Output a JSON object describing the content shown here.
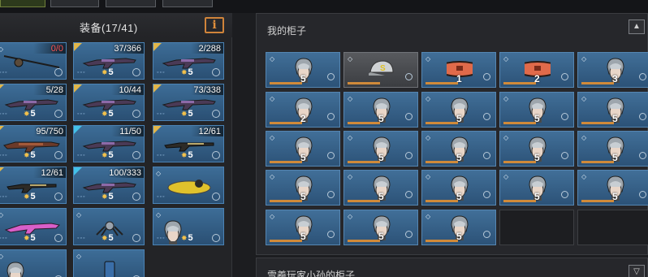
{
  "equipment": {
    "title": "装备(17/41)",
    "info_label": "i",
    "items": [
      {
        "count": "0/0",
        "count_red": true,
        "icon": "fishing-rod-icon",
        "level": "",
        "tag": ""
      },
      {
        "count": "37/366",
        "icon": "rifle-icon",
        "level": "5",
        "tag": "gold"
      },
      {
        "count": "2/288",
        "icon": "rifle-icon",
        "level": "5",
        "tag": "gold"
      },
      {
        "count": "5/28",
        "icon": "rifle-icon",
        "level": "5",
        "tag": "gold"
      },
      {
        "count": "10/44",
        "icon": "rifle-icon",
        "level": "5",
        "tag": "gold"
      },
      {
        "count": "73/338",
        "icon": "rifle-icon",
        "level": "5",
        "tag": "gold"
      },
      {
        "count": "95/750",
        "icon": "machine-gun-icon",
        "level": "5",
        "tag": "gold"
      },
      {
        "count": "11/50",
        "icon": "rifle-icon",
        "level": "5",
        "tag": "blue"
      },
      {
        "count": "12/61",
        "icon": "shotgun-icon",
        "level": "5",
        "tag": "gold"
      },
      {
        "count": "12/61",
        "icon": "shotgun-icon",
        "level": "5",
        "tag": "gold"
      },
      {
        "count": "100/333",
        "icon": "rifle-icon",
        "level": "5",
        "tag": "blue"
      },
      {
        "count": "",
        "icon": "yellow-drill-icon",
        "level": "",
        "tag": ""
      },
      {
        "count": "",
        "icon": "pink-rifle-icon",
        "level": "5",
        "tag": ""
      },
      {
        "count": "",
        "icon": "spider-bot-icon",
        "level": "5",
        "tag": ""
      },
      {
        "count": "",
        "icon": "character-head-icon",
        "level": "5",
        "tag": ""
      },
      {
        "count": "",
        "icon": "character-head-icon",
        "level": "",
        "tag": ""
      },
      {
        "count": "",
        "icon": "canister-icon",
        "level": "",
        "tag": ""
      }
    ]
  },
  "cabinet": {
    "title": "我的柜子",
    "collapse_label": "▲",
    "items": [
      {
        "num": "5",
        "icon": "character-head-icon",
        "bg": "blue"
      },
      {
        "num": "",
        "icon": "cap-icon",
        "bg": "gray"
      },
      {
        "num": "1",
        "icon": "goggles-icon",
        "bg": "blue"
      },
      {
        "num": "2",
        "icon": "goggles-icon",
        "bg": "blue"
      },
      {
        "num": "3",
        "icon": "character-head-icon",
        "bg": "blue"
      },
      {
        "num": "2",
        "icon": "character-head-icon",
        "bg": "blue"
      },
      {
        "num": "5",
        "icon": "character-head-icon",
        "bg": "blue"
      },
      {
        "num": "5",
        "icon": "character-head-icon",
        "bg": "blue"
      },
      {
        "num": "5",
        "icon": "character-head-icon",
        "bg": "blue"
      },
      {
        "num": "5",
        "icon": "character-head-icon",
        "bg": "blue"
      },
      {
        "num": "5",
        "icon": "character-head-icon",
        "bg": "blue"
      },
      {
        "num": "5",
        "icon": "character-head-icon",
        "bg": "blue"
      },
      {
        "num": "5",
        "icon": "character-head-icon",
        "bg": "blue"
      },
      {
        "num": "5",
        "icon": "character-head-icon",
        "bg": "blue"
      },
      {
        "num": "5",
        "icon": "character-head-icon",
        "bg": "blue"
      },
      {
        "num": "5",
        "icon": "character-head-icon",
        "bg": "blue"
      },
      {
        "num": "5",
        "icon": "character-head-icon",
        "bg": "blue"
      },
      {
        "num": "5",
        "icon": "character-head-icon",
        "bg": "blue"
      },
      {
        "num": "5",
        "icon": "character-head-icon",
        "bg": "blue"
      },
      {
        "num": "5",
        "icon": "character-head-icon",
        "bg": "blue"
      },
      {
        "num": "5",
        "icon": "character-head-icon",
        "bg": "blue"
      },
      {
        "num": "5",
        "icon": "character-head-icon",
        "bg": "blue"
      },
      {
        "num": "5",
        "icon": "character-head-icon",
        "bg": "blue"
      },
      {
        "num": "",
        "icon": "",
        "bg": "empty"
      },
      {
        "num": "",
        "icon": "",
        "bg": "empty"
      }
    ]
  },
  "other_cabinet": {
    "title": "雪羲玩家小孙的柜子",
    "collapse_label": "▽"
  }
}
